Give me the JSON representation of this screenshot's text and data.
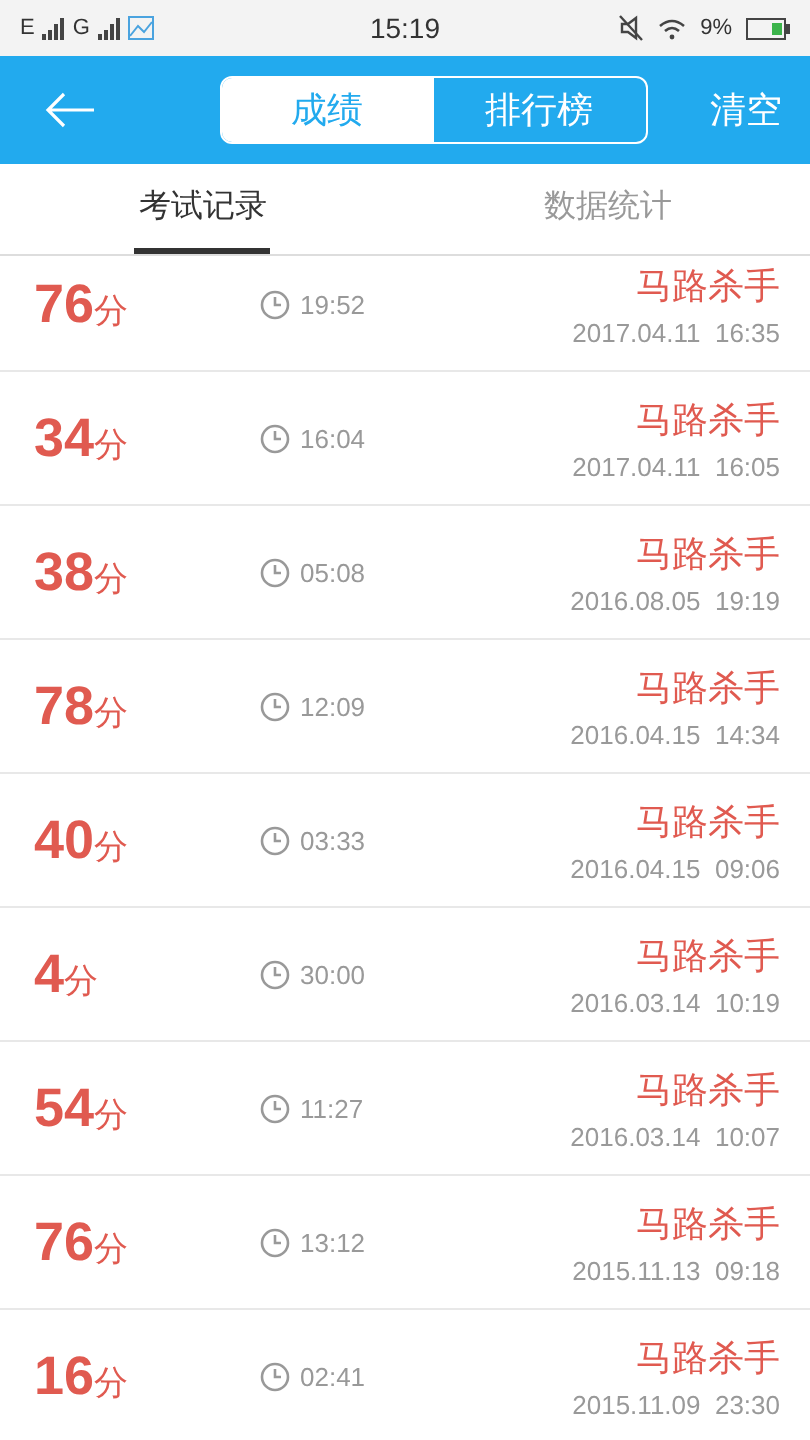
{
  "status_bar": {
    "network_1": "E",
    "network_2": "G",
    "time": "15:19",
    "battery": "9%"
  },
  "header": {
    "segments": [
      {
        "label": "成绩",
        "selected": true
      },
      {
        "label": "排行榜",
        "selected": false
      }
    ],
    "action": "清空"
  },
  "tabs": [
    {
      "label": "考试记录",
      "selected": true
    },
    {
      "label": "数据统计",
      "selected": false
    }
  ],
  "records": [
    {
      "score": "76",
      "unit": "分",
      "duration": "19:52",
      "name": "马路杀手",
      "date": "2017.04.11  16:35"
    },
    {
      "score": "34",
      "unit": "分",
      "duration": "16:04",
      "name": "马路杀手",
      "date": "2017.04.11  16:05"
    },
    {
      "score": "38",
      "unit": "分",
      "duration": "05:08",
      "name": "马路杀手",
      "date": "2016.08.05  19:19"
    },
    {
      "score": "78",
      "unit": "分",
      "duration": "12:09",
      "name": "马路杀手",
      "date": "2016.04.15  14:34"
    },
    {
      "score": "40",
      "unit": "分",
      "duration": "03:33",
      "name": "马路杀手",
      "date": "2016.04.15  09:06"
    },
    {
      "score": "4",
      "unit": "分",
      "duration": "30:00",
      "name": "马路杀手",
      "date": "2016.03.14  10:19"
    },
    {
      "score": "54",
      "unit": "分",
      "duration": "11:27",
      "name": "马路杀手",
      "date": "2016.03.14  10:07"
    },
    {
      "score": "76",
      "unit": "分",
      "duration": "13:12",
      "name": "马路杀手",
      "date": "2015.11.13  09:18"
    },
    {
      "score": "16",
      "unit": "分",
      "duration": "02:41",
      "name": "马路杀手",
      "date": "2015.11.09  23:30"
    }
  ]
}
